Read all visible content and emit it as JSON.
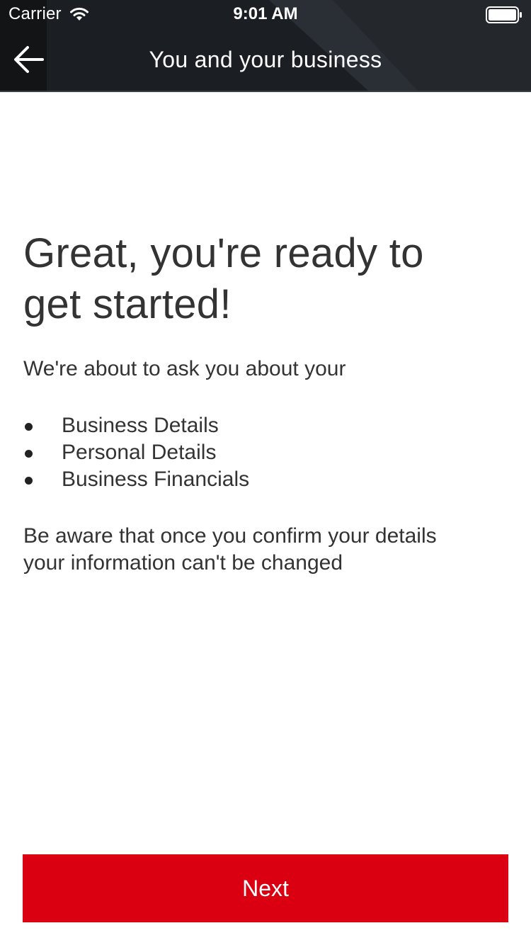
{
  "status_bar": {
    "carrier": "Carrier",
    "time": "9:01 AM"
  },
  "nav": {
    "title": "You and your business",
    "back_icon": "arrow-left-icon"
  },
  "content": {
    "headline_line1": "Great, you're ready to",
    "headline_line2": "get started!",
    "intro": "We're about to ask you about your",
    "items": [
      {
        "label": "Business Details"
      },
      {
        "label": "Personal Details"
      },
      {
        "label": "Business Financials"
      }
    ],
    "warning_line1": "Be aware that once you confirm your details",
    "warning_line2": "your information can't be changed"
  },
  "actions": {
    "next_label": "Next"
  },
  "colors": {
    "header_bg": "#1b1e22",
    "accent": "#db0011",
    "text": "#333333"
  }
}
